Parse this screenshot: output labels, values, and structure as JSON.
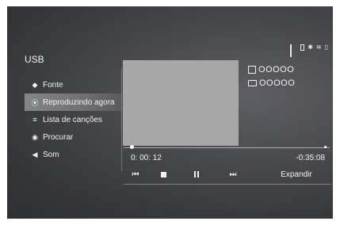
{
  "header": {
    "title": "USB"
  },
  "status_icons": [
    "signal-icon",
    "battery-icon",
    "bluetooth-icon",
    "wifi-icon",
    "network-icon"
  ],
  "sidebar": {
    "items": [
      {
        "label": "Fonte",
        "icon": "source-icon"
      },
      {
        "label": "Reproduzindo agora",
        "icon": "play-circle-icon",
        "active": true
      },
      {
        "label": "Lista de canções",
        "icon": "playlist-icon"
      },
      {
        "label": "Procurar",
        "icon": "eye-icon"
      },
      {
        "label": "Som",
        "icon": "speaker-icon"
      }
    ]
  },
  "track": {
    "file_name": "OOOOO",
    "folder_name": "OOOOO"
  },
  "playback": {
    "elapsed": "0: 00: 12",
    "remaining": "-0:35:08",
    "progress": 0.04
  },
  "controls": {
    "expand_label": "Expandir"
  }
}
